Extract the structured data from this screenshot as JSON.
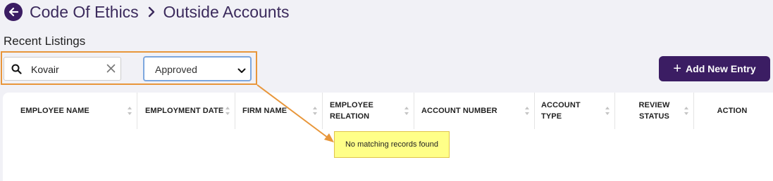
{
  "breadcrumb": {
    "parent": "Code Of Ethics",
    "current": "Outside Accounts"
  },
  "subtitle": "Recent Listings",
  "search": {
    "value": "Kovair",
    "placeholder": ""
  },
  "status_filter": {
    "selected": "Approved"
  },
  "add_button": {
    "label": "Add New Entry"
  },
  "table": {
    "columns": [
      {
        "line1": "EMPLOYEE NAME",
        "line2": ""
      },
      {
        "line1": "EMPLOYMENT DATE",
        "line2": ""
      },
      {
        "line1": "FIRM NAME",
        "line2": ""
      },
      {
        "line1": "EMPLOYEE",
        "line2": "RELATION"
      },
      {
        "line1": "ACCOUNT NUMBER",
        "line2": ""
      },
      {
        "line1": "ACCOUNT",
        "line2": "TYPE"
      },
      {
        "line1": "REVIEW",
        "line2": "STATUS"
      },
      {
        "line1": "ACTION",
        "line2": ""
      }
    ],
    "empty_message": "No matching records found"
  },
  "colors": {
    "primary": "#3b1d63",
    "highlight": "#e8963a",
    "callout_bg": "#ffff88"
  }
}
